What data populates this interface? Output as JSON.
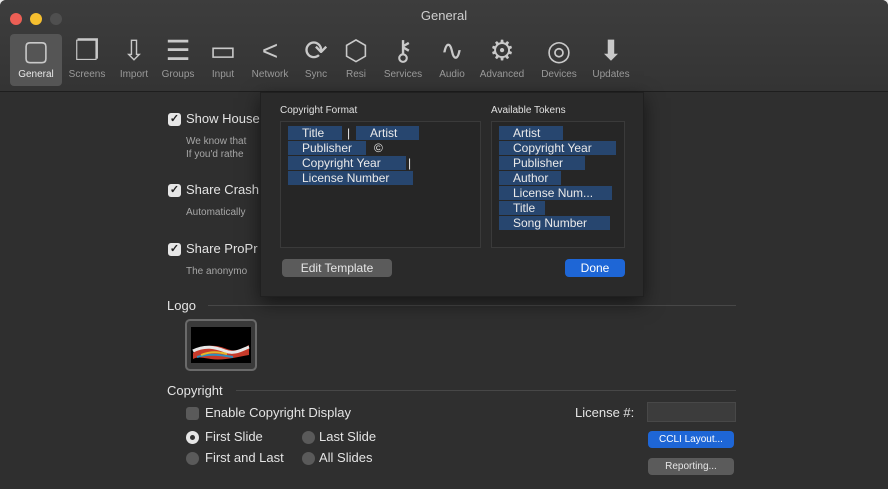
{
  "window": {
    "title": "General"
  },
  "colors": {
    "close": "#ec5f55",
    "minimize": "#f5bf2f",
    "zoom": "#4f4f4f",
    "accent": "#1e66d6",
    "token": "#27466f"
  },
  "toolbar": [
    {
      "label": "General",
      "icon": "general-icon",
      "glyph": "▢"
    },
    {
      "label": "Screens",
      "icon": "screens-icon",
      "glyph": "❐"
    },
    {
      "label": "Import",
      "icon": "import-icon",
      "glyph": "⇩"
    },
    {
      "label": "Groups",
      "icon": "groups-icon",
      "glyph": "☰"
    },
    {
      "label": "Input",
      "icon": "input-icon",
      "glyph": "▭"
    },
    {
      "label": "Network",
      "icon": "network-icon",
      "glyph": "<"
    },
    {
      "label": "Sync",
      "icon": "sync-icon",
      "glyph": "⟳"
    },
    {
      "label": "Resi",
      "icon": "resi-icon",
      "glyph": "⬡"
    },
    {
      "label": "Services",
      "icon": "services-icon",
      "glyph": "⚷"
    },
    {
      "label": "Audio",
      "icon": "audio-icon",
      "glyph": "∿"
    },
    {
      "label": "Advanced",
      "icon": "advanced-icon",
      "glyph": "⚙"
    },
    {
      "label": "Devices",
      "icon": "devices-icon",
      "glyph": "◎"
    },
    {
      "label": "Updates",
      "icon": "updates-icon",
      "glyph": "⬇"
    }
  ],
  "settings": {
    "show_house": {
      "label": "Show House",
      "desc1": "We know that",
      "desc2": "If you'd rathe"
    },
    "share_crash": {
      "label": "Share Crash",
      "desc": "Automatically"
    },
    "share_propr": {
      "label": "Share ProPr",
      "desc": "The anonymo"
    }
  },
  "logo": {
    "label": "Logo"
  },
  "copyright": {
    "label": "Copyright",
    "enable_label": "Enable Copyright Display",
    "radio_first": "First Slide",
    "radio_last": "Last Slide",
    "radio_first_last": "First and Last",
    "radio_all": "All Slides",
    "license_label": "License #:",
    "license_value": "",
    "ccli_button": "CCLI Layout...",
    "reporting_button": "Reporting..."
  },
  "popup": {
    "format_label": "Copyright Format",
    "tokens_label": "Available Tokens",
    "format_tokens": [
      {
        "text": "Title"
      },
      {
        "text": "|"
      },
      {
        "text": "Artist"
      },
      {
        "text": "Publisher"
      },
      {
        "text": "©"
      },
      {
        "text": "Copyright Year"
      },
      {
        "text": "|"
      },
      {
        "text": "License Number"
      }
    ],
    "available_tokens": [
      "Artist",
      "Copyright Year",
      "Publisher",
      "Author",
      "License Num...",
      "Title",
      "Song Number"
    ],
    "edit_button": "Edit Template",
    "done_button": "Done"
  }
}
